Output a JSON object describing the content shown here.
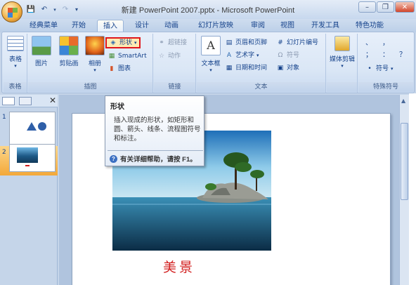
{
  "window": {
    "title": "新建 PowerPoint 2007.pptx - Microsoft PowerPoint",
    "controls": {
      "minimize": "–",
      "restore": "❐",
      "close": "✕"
    }
  },
  "quick_access": {
    "items": [
      "save-icon",
      "undo-icon",
      "redo-icon",
      "customize-icon"
    ]
  },
  "tabs": [
    "经典菜单",
    "开始",
    "插入",
    "设计",
    "动画",
    "幻灯片放映",
    "审阅",
    "视图",
    "开发工具",
    "特色功能"
  ],
  "active_tab": "插入",
  "ribbon": {
    "groups": {
      "table": {
        "label": "表格",
        "button": "表格"
      },
      "illustrations": {
        "label": "插图",
        "picture": "图片",
        "clipart": "剪贴画",
        "album": "相册",
        "shape": "形状",
        "smartart": "SmartArt",
        "chart": "图表"
      },
      "links": {
        "label": "链接",
        "hyperlink": "超链接",
        "action": "动作"
      },
      "text": {
        "label": "文本",
        "textbox": "文本框",
        "header_footer": "页眉和页脚",
        "wordart": "艺术字",
        "datetime": "日期和时间",
        "slide_number": "幻灯片编号",
        "symbol": "符号",
        "object": "对象"
      },
      "media": {
        "label": "",
        "clip": "媒体剪辑"
      },
      "special": {
        "label": "特殊符号",
        "symbol": "符号",
        "chars": [
          "、",
          "，",
          "；",
          "：",
          "？"
        ]
      }
    }
  },
  "slide_pane": {
    "slides": [
      {
        "number": "1"
      },
      {
        "number": "2"
      }
    ]
  },
  "slide": {
    "caption": "美景"
  },
  "tooltip": {
    "title": "形状",
    "body": "插入现成的形状，如矩形和圆、箭头、线条、流程图符号和标注。",
    "help": "有关详细帮助，请按 F1。"
  },
  "colors": {
    "accent_red": "#d21e1e",
    "highlight": "#e0161b",
    "ribbon": "#dbe7f6"
  }
}
